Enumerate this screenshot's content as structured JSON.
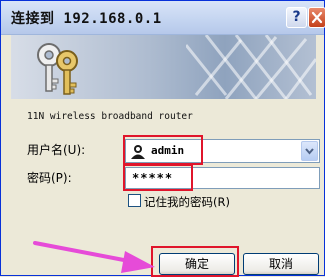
{
  "dialog": {
    "title": "连接到 192.168.0.1",
    "help_glyph": "?",
    "router_name": "11N wireless broadband router"
  },
  "form": {
    "username_label": "用户名(U):",
    "username_value": "admin",
    "password_label": "密码(P):",
    "password_value": "*****",
    "remember_label": "记住我的密码(R)",
    "remember_checked": false
  },
  "buttons": {
    "ok": "确定",
    "cancel": "取消"
  },
  "colors": {
    "highlight": "#e0152b",
    "arrow": "#e64bd8",
    "window_border": "#0831d9"
  },
  "icons": [
    "keys-icon",
    "help-icon",
    "close-icon",
    "user-icon",
    "chevron-down-icon",
    "arrow-pointer-icon"
  ]
}
